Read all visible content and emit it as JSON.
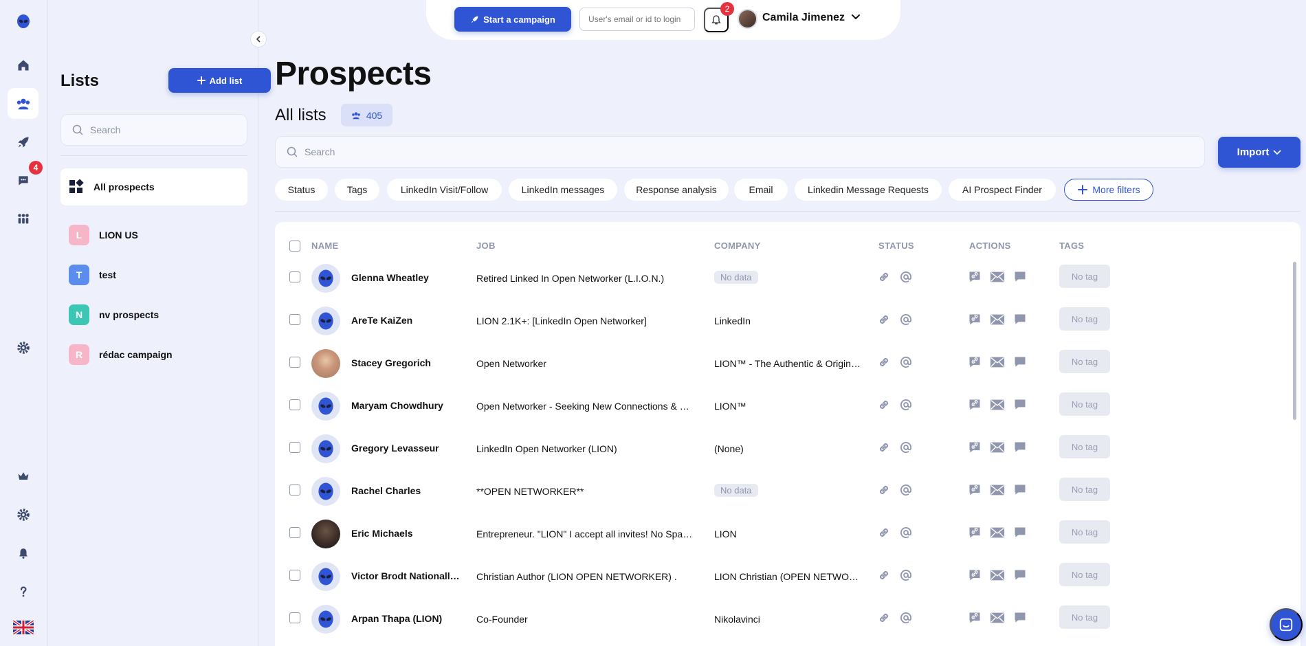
{
  "app": {
    "rail": {
      "messages_badge": "4"
    },
    "language_flag": "uk-flag"
  },
  "lists_panel": {
    "title": "Lists",
    "add_list_label": "Add list",
    "search_placeholder": "Search",
    "all_prospects_label": "All prospects",
    "items": [
      {
        "initial": "L",
        "label": "LION US",
        "color": "#f7b6c8"
      },
      {
        "initial": "T",
        "label": "test",
        "color": "#5b8def"
      },
      {
        "initial": "N",
        "label": "nv prospects",
        "color": "#3cc7b5"
      },
      {
        "initial": "R",
        "label": "rédac campaign",
        "color": "#f7b6c8"
      }
    ]
  },
  "topbar": {
    "start_campaign_label": "Start a campaign",
    "login_placeholder": "User's email or id to login",
    "notifications_count": "2",
    "user_name": "Camila Jimenez"
  },
  "main": {
    "title": "Prospects",
    "subtitle": "All lists",
    "count": "405",
    "search_placeholder": "Search",
    "import_label": "Import",
    "filters": [
      "Status",
      "Tags",
      "LinkedIn Visit/Follow",
      "LinkedIn messages",
      "Response analysis",
      "Email",
      "Linkedin Message Requests",
      "AI Prospect Finder"
    ],
    "more_filters_label": "More filters"
  },
  "table": {
    "columns": {
      "name": "NAME",
      "job": "JOB",
      "company": "COMPANY",
      "status": "STATUS",
      "actions": "ACTIONS",
      "tags": "TAGS"
    },
    "no_data_label": "No data",
    "no_tag_label": "No tag",
    "rows": [
      {
        "name": "Glenna Wheatley",
        "job": "Retired Linked In Open Networker (L.I.O.N.)",
        "company": "",
        "avatar": "alien"
      },
      {
        "name": "AreTe KaiZen",
        "job": "LION 2.1K+: [LinkedIn Open Networker]",
        "company": "LinkedIn",
        "avatar": "alien"
      },
      {
        "name": "Stacey Gregorich",
        "job": "Open Networker",
        "company": "LION™ - The Authentic & Original LION",
        "avatar": "photo-a"
      },
      {
        "name": "Maryam Chowdhury",
        "job": "Open Networker - Seeking New Connections & Opportunities",
        "company": "LION™",
        "avatar": "alien"
      },
      {
        "name": "Gregory Levasseur",
        "job": "LinkedIn Open Networker (LION)",
        "company": "(None)",
        "avatar": "alien"
      },
      {
        "name": "Rachel Charles",
        "job": "**OPEN NETWORKER**",
        "company": "",
        "avatar": "alien"
      },
      {
        "name": "Eric Michaels",
        "job": "Entrepreneur. \"LION\" I accept all invites! No Spam please",
        "company": "LION",
        "avatar": "photo-b"
      },
      {
        "name": "Victor Brodt Nationally Known",
        "job": "Christian Author (LION OPEN NETWORKER) .",
        "company": "LION Christian (OPEN NETWORKER)",
        "avatar": "alien"
      },
      {
        "name": "Arpan Thapa (LION)",
        "job": "Co-Founder",
        "company": "Nikolavinci",
        "avatar": "alien"
      }
    ]
  },
  "colors": {
    "accent": "#2f55d4",
    "badge": "#e5323f",
    "background": "#eef0fb",
    "muted": "#8f96ad"
  }
}
